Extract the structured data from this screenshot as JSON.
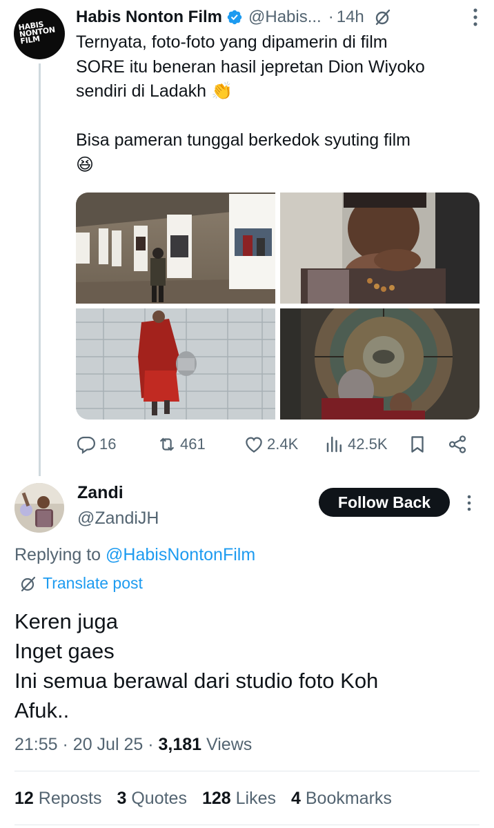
{
  "parent_tweet": {
    "avatar_text": [
      "HABIS",
      "NONTON",
      "FILM"
    ],
    "display_name": "Habis Nonton Film",
    "handle": "@Habis...",
    "separator": "·",
    "time": "14h",
    "text_lines": [
      "Ternyata, foto-foto yang dipamerin di film",
      "SORE itu beneran hasil jepretan Dion Wiyoko",
      "sendiri di Ladakh 👏",
      "",
      "Bisa pameran tunggal berkedok syuting film",
      "😆"
    ],
    "actions": {
      "replies": "16",
      "reposts": "461",
      "likes": "2.4K",
      "views": "42.5K"
    }
  },
  "reply": {
    "display_name": "Zandi",
    "handle": "@ZandiJH",
    "follow_label": "Follow Back",
    "replying_prefix": "Replying to ",
    "replying_mention": "@HabisNontonFilm",
    "translate_label": "Translate post",
    "text_lines": [
      "Keren juga",
      "Inget gaes",
      "Ini semua berawal dari studio foto Koh",
      "Afuk.."
    ],
    "meta": {
      "time": "21:55",
      "date": "20 Jul 25",
      "views_count": "3,181",
      "views_label": "Views"
    },
    "stats": {
      "reposts_count": "12",
      "reposts_label": "Reposts",
      "quotes_count": "3",
      "quotes_label": "Quotes",
      "likes_count": "128",
      "likes_label": "Likes",
      "bookmarks_count": "4",
      "bookmarks_label": "Bookmarks"
    }
  },
  "colors": {
    "accent": "#1d9bf0",
    "text": "#0f1419",
    "secondary": "#536471",
    "button_bg": "#0f1419"
  },
  "icons": [
    "verified-badge-icon",
    "grok-icon",
    "more-icon",
    "reply-icon",
    "repost-icon",
    "like-icon",
    "views-icon",
    "bookmark-icon",
    "share-icon",
    "translate-icon"
  ]
}
